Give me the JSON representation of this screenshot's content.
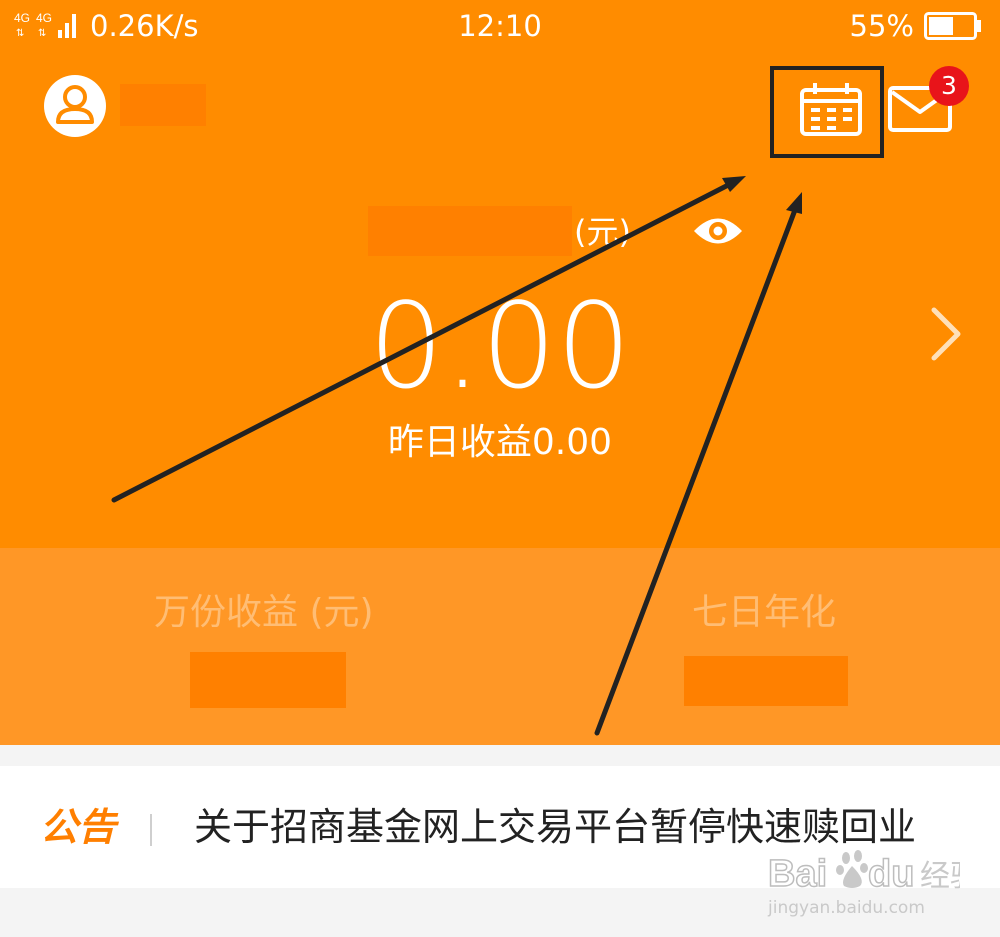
{
  "status_bar": {
    "network_label": "4G 4G",
    "speed": "0.26K/s",
    "time": "12:10",
    "battery_percent": "55%",
    "battery_level": 0.55
  },
  "header": {
    "avatar_icon": "user-icon",
    "calendar_icon": "calendar-icon",
    "mail_icon": "mail-icon",
    "mail_badge": "3"
  },
  "balance": {
    "unit": "(元)",
    "eye_icon": "eye-icon",
    "amount": "0.00",
    "yesterday_earnings": "昨日收益0.00",
    "chevron_icon": "chevron-right-icon"
  },
  "stats": {
    "per_10k_label": "万份收益 (元)",
    "seven_day_label": "七日年化"
  },
  "notice": {
    "tag": "公告",
    "text": "关于招商基金网上交易平台暂停快速赎回业"
  },
  "watermark": {
    "brand": "Baidu 经验",
    "url": "jingyan.baidu.com"
  },
  "colors": {
    "primary": "#ff8c00",
    "stats_band": "#ff9726",
    "badge": "#e8141a",
    "notice_tag": "#ff7f00"
  }
}
